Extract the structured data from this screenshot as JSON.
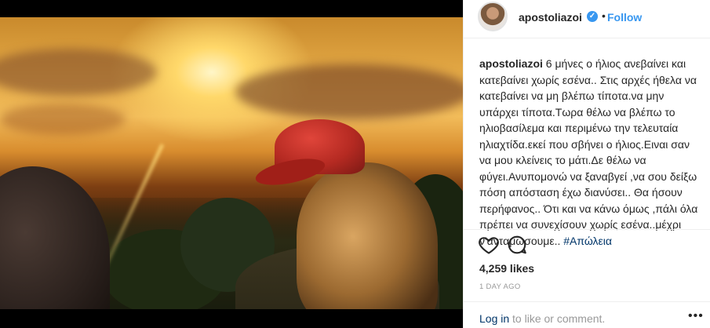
{
  "post": {
    "username": "apostoliazoi",
    "separator": "•",
    "follow_label": "Follow",
    "verified_glyph": "✓",
    "caption_text": "6 μήνες ο ήλιος ανεβαίνει και κατεβαίνει χωρίς εσένα.. Στις αρχές ήθελα να κατεβαίνει να μη βλέπω τίποτα.να μην υπάρχει τίποτα.Τωρα θέλω να βλέπω το ηλιοβασίλεμα και περιμένω την τελευταία ηλιαχτίδα.εκεί που σβήνει ο ήλιος.Ειναι σαν να μου κλείνεις το μάτι.Δε θέλω να φύγει.Ανυπομονώ να ξαναβγεί ,να σου δείξω πόση απόσταση έχω διανύσει.. Θα ήσουν περήφανος.. Ότι και να κάνω όμως ,πάλι όλα πρέπει να συνεχίσουν χωρίς εσένα..μέχρι ν'ανταμωσουμε..",
    "hashtag": "#Απώλεια",
    "likes": "4,259 likes",
    "time_ago": "1 DAY AGO",
    "login_link": "Log in",
    "login_rest": " to like or comment.",
    "more_glyph": "•••"
  },
  "icons": {
    "verified": "verified-badge-icon",
    "like": "heart-icon",
    "comment": "comment-bubble-icon",
    "more": "more-options-icon"
  },
  "colors": {
    "link_blue": "#3897f0",
    "hashtag": "#003569",
    "text": "#262626",
    "muted": "#999999"
  }
}
